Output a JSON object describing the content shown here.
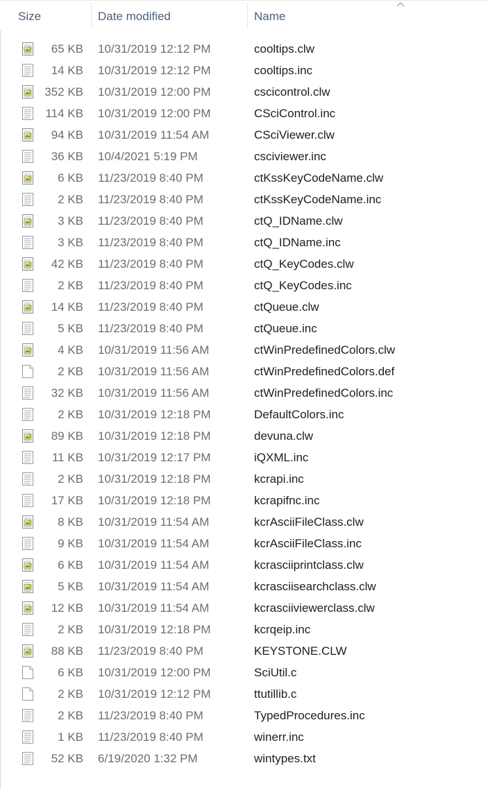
{
  "columns": {
    "size": "Size",
    "date": "Date modified",
    "name": "Name"
  },
  "files": [
    {
      "size": "65 KB",
      "date": "10/31/2019 12:12 PM",
      "name": "cooltips.clw",
      "icon": "clw-file-icon"
    },
    {
      "size": "14 KB",
      "date": "10/31/2019 12:12 PM",
      "name": "cooltips.inc",
      "icon": "text-file-icon"
    },
    {
      "size": "352 KB",
      "date": "10/31/2019 12:00 PM",
      "name": "cscicontrol.clw",
      "icon": "clw-file-icon"
    },
    {
      "size": "114 KB",
      "date": "10/31/2019 12:00 PM",
      "name": "CSciControl.inc",
      "icon": "text-file-icon"
    },
    {
      "size": "94 KB",
      "date": "10/31/2019 11:54 AM",
      "name": "CSciViewer.clw",
      "icon": "clw-file-icon"
    },
    {
      "size": "36 KB",
      "date": "10/4/2021 5:19 PM",
      "name": "csciviewer.inc",
      "icon": "text-file-icon"
    },
    {
      "size": "6 KB",
      "date": "11/23/2019 8:40 PM",
      "name": "ctKssKeyCodeName.clw",
      "icon": "clw-file-icon"
    },
    {
      "size": "2 KB",
      "date": "11/23/2019 8:40 PM",
      "name": "ctKssKeyCodeName.inc",
      "icon": "text-file-icon"
    },
    {
      "size": "3 KB",
      "date": "11/23/2019 8:40 PM",
      "name": "ctQ_IDName.clw",
      "icon": "clw-file-icon"
    },
    {
      "size": "3 KB",
      "date": "11/23/2019 8:40 PM",
      "name": "ctQ_IDName.inc",
      "icon": "text-file-icon"
    },
    {
      "size": "42 KB",
      "date": "11/23/2019 8:40 PM",
      "name": "ctQ_KeyCodes.clw",
      "icon": "clw-file-icon"
    },
    {
      "size": "2 KB",
      "date": "11/23/2019 8:40 PM",
      "name": "ctQ_KeyCodes.inc",
      "icon": "text-file-icon"
    },
    {
      "size": "14 KB",
      "date": "11/23/2019 8:40 PM",
      "name": "ctQueue.clw",
      "icon": "clw-file-icon"
    },
    {
      "size": "5 KB",
      "date": "11/23/2019 8:40 PM",
      "name": "ctQueue.inc",
      "icon": "text-file-icon"
    },
    {
      "size": "4 KB",
      "date": "10/31/2019 11:56 AM",
      "name": "ctWinPredefinedColors.clw",
      "icon": "clw-file-icon"
    },
    {
      "size": "2 KB",
      "date": "10/31/2019 11:56 AM",
      "name": "ctWinPredefinedColors.def",
      "icon": "blank-file-icon"
    },
    {
      "size": "32 KB",
      "date": "10/31/2019 11:56 AM",
      "name": "ctWinPredefinedColors.inc",
      "icon": "text-file-icon"
    },
    {
      "size": "2 KB",
      "date": "10/31/2019 12:18 PM",
      "name": "DefaultColors.inc",
      "icon": "text-file-icon"
    },
    {
      "size": "89 KB",
      "date": "10/31/2019 12:18 PM",
      "name": "devuna.clw",
      "icon": "clw-file-icon"
    },
    {
      "size": "11 KB",
      "date": "10/31/2019 12:17 PM",
      "name": "iQXML.inc",
      "icon": "text-file-icon"
    },
    {
      "size": "2 KB",
      "date": "10/31/2019 12:18 PM",
      "name": "kcrapi.inc",
      "icon": "text-file-icon"
    },
    {
      "size": "17 KB",
      "date": "10/31/2019 12:18 PM",
      "name": "kcrapifnc.inc",
      "icon": "text-file-icon"
    },
    {
      "size": "8 KB",
      "date": "10/31/2019 11:54 AM",
      "name": "kcrAsciiFileClass.clw",
      "icon": "clw-file-icon"
    },
    {
      "size": "9 KB",
      "date": "10/31/2019 11:54 AM",
      "name": "kcrAsciiFileClass.inc",
      "icon": "text-file-icon"
    },
    {
      "size": "6 KB",
      "date": "10/31/2019 11:54 AM",
      "name": "kcrasciiprintclass.clw",
      "icon": "clw-file-icon"
    },
    {
      "size": "5 KB",
      "date": "10/31/2019 11:54 AM",
      "name": "kcrasciisearchclass.clw",
      "icon": "clw-file-icon"
    },
    {
      "size": "12 KB",
      "date": "10/31/2019 11:54 AM",
      "name": "kcrasciiviewerclass.clw",
      "icon": "clw-file-icon"
    },
    {
      "size": "2 KB",
      "date": "10/31/2019 12:18 PM",
      "name": "kcrqeip.inc",
      "icon": "text-file-icon"
    },
    {
      "size": "88 KB",
      "date": "11/23/2019 8:40 PM",
      "name": "KEYSTONE.CLW",
      "icon": "clw-file-icon"
    },
    {
      "size": "6 KB",
      "date": "10/31/2019 12:00 PM",
      "name": "SciUtil.c",
      "icon": "blank-file-icon"
    },
    {
      "size": "2 KB",
      "date": "10/31/2019 12:12 PM",
      "name": "ttutillib.c",
      "icon": "blank-file-icon"
    },
    {
      "size": "2 KB",
      "date": "11/23/2019 8:40 PM",
      "name": "TypedProcedures.inc",
      "icon": "text-file-icon"
    },
    {
      "size": "1 KB",
      "date": "11/23/2019 8:40 PM",
      "name": "winerr.inc",
      "icon": "text-file-icon"
    },
    {
      "size": "52 KB",
      "date": "6/19/2020 1:32 PM",
      "name": "wintypes.txt",
      "icon": "text-file-icon"
    }
  ]
}
